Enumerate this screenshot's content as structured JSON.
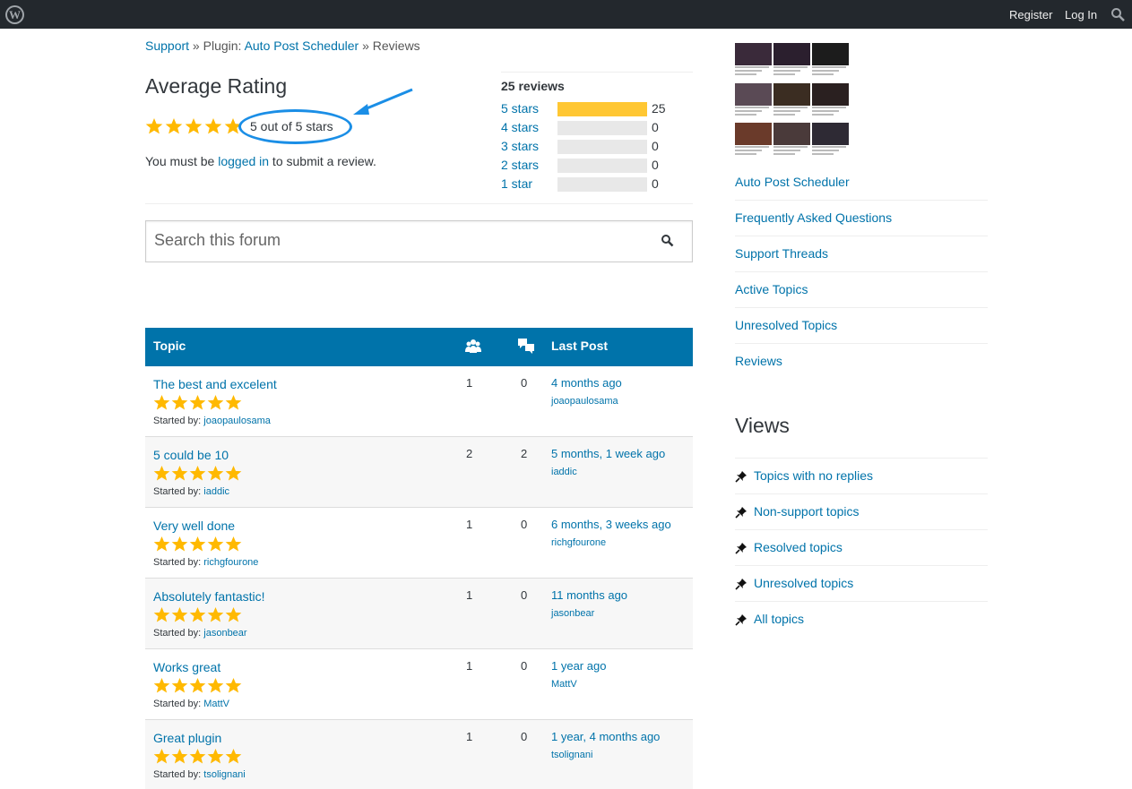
{
  "topbar": {
    "register": "Register",
    "login": "Log In"
  },
  "breadcrumb": {
    "support": "Support",
    "sep1": " » ",
    "plugin_prefix": "Plugin: ",
    "plugin": "Auto Post Scheduler",
    "sep2": " » ",
    "current": "Reviews"
  },
  "rating": {
    "title": "Average Rating",
    "text": "5 out of 5 stars",
    "stars": 5,
    "login_prefix": "You must be ",
    "login_link": "logged in",
    "login_suffix": " to submit a review."
  },
  "histogram": {
    "title": "25 reviews",
    "rows": [
      {
        "label": "5 stars",
        "count": "25",
        "fraction": 1.0
      },
      {
        "label": "4 stars",
        "count": "0",
        "fraction": 0
      },
      {
        "label": "3 stars",
        "count": "0",
        "fraction": 0
      },
      {
        "label": "2 stars",
        "count": "0",
        "fraction": 0
      },
      {
        "label": "1 star",
        "count": "0",
        "fraction": 0
      }
    ]
  },
  "search": {
    "placeholder": "Search this forum"
  },
  "table": {
    "header": {
      "topic": "Topic",
      "last_post": "Last Post"
    },
    "started_by_label": "Started by: ",
    "rows": [
      {
        "title": "The best and excelent",
        "author": "joaopaulosama",
        "voices": "1",
        "posts": "0",
        "time": "4 months ago",
        "last_user": "joaopaulosama"
      },
      {
        "title": "5 could be 10",
        "author": "iaddic",
        "voices": "2",
        "posts": "2",
        "time": "5 months, 1 week ago",
        "last_user": "iaddic"
      },
      {
        "title": "Very well done",
        "author": "richgfourone",
        "voices": "1",
        "posts": "0",
        "time": "6 months, 3 weeks ago",
        "last_user": "richgfourone"
      },
      {
        "title": "Absolutely fantastic!",
        "author": "jasonbear",
        "voices": "1",
        "posts": "0",
        "time": "11 months ago",
        "last_user": "jasonbear"
      },
      {
        "title": "Works great",
        "author": "MattV",
        "voices": "1",
        "posts": "0",
        "time": "1 year ago",
        "last_user": "MattV"
      },
      {
        "title": "Great plugin",
        "author": "tsolignani",
        "voices": "1",
        "posts": "0",
        "time": "1 year, 4 months ago",
        "last_user": "tsolignani"
      }
    ]
  },
  "sidebar": {
    "links": [
      "Auto Post Scheduler",
      "Frequently Asked Questions",
      "Support Threads",
      "Active Topics",
      "Unresolved Topics",
      "Reviews"
    ],
    "views_title": "Views",
    "views": [
      "Topics with no replies",
      "Non-support topics",
      "Resolved topics",
      "Unresolved topics",
      "All topics"
    ]
  },
  "colors": {
    "accent": "#0073aa",
    "star": "#ffb900",
    "bar_fill": "#ffc733",
    "topbar": "#23282d",
    "annotation": "#1a8ee6"
  },
  "icons": {
    "logo": "wordpress-logo-icon",
    "search": "search-icon",
    "voices": "voices-icon",
    "posts": "posts-icon",
    "pin": "pin-icon",
    "star": "star-icon"
  }
}
